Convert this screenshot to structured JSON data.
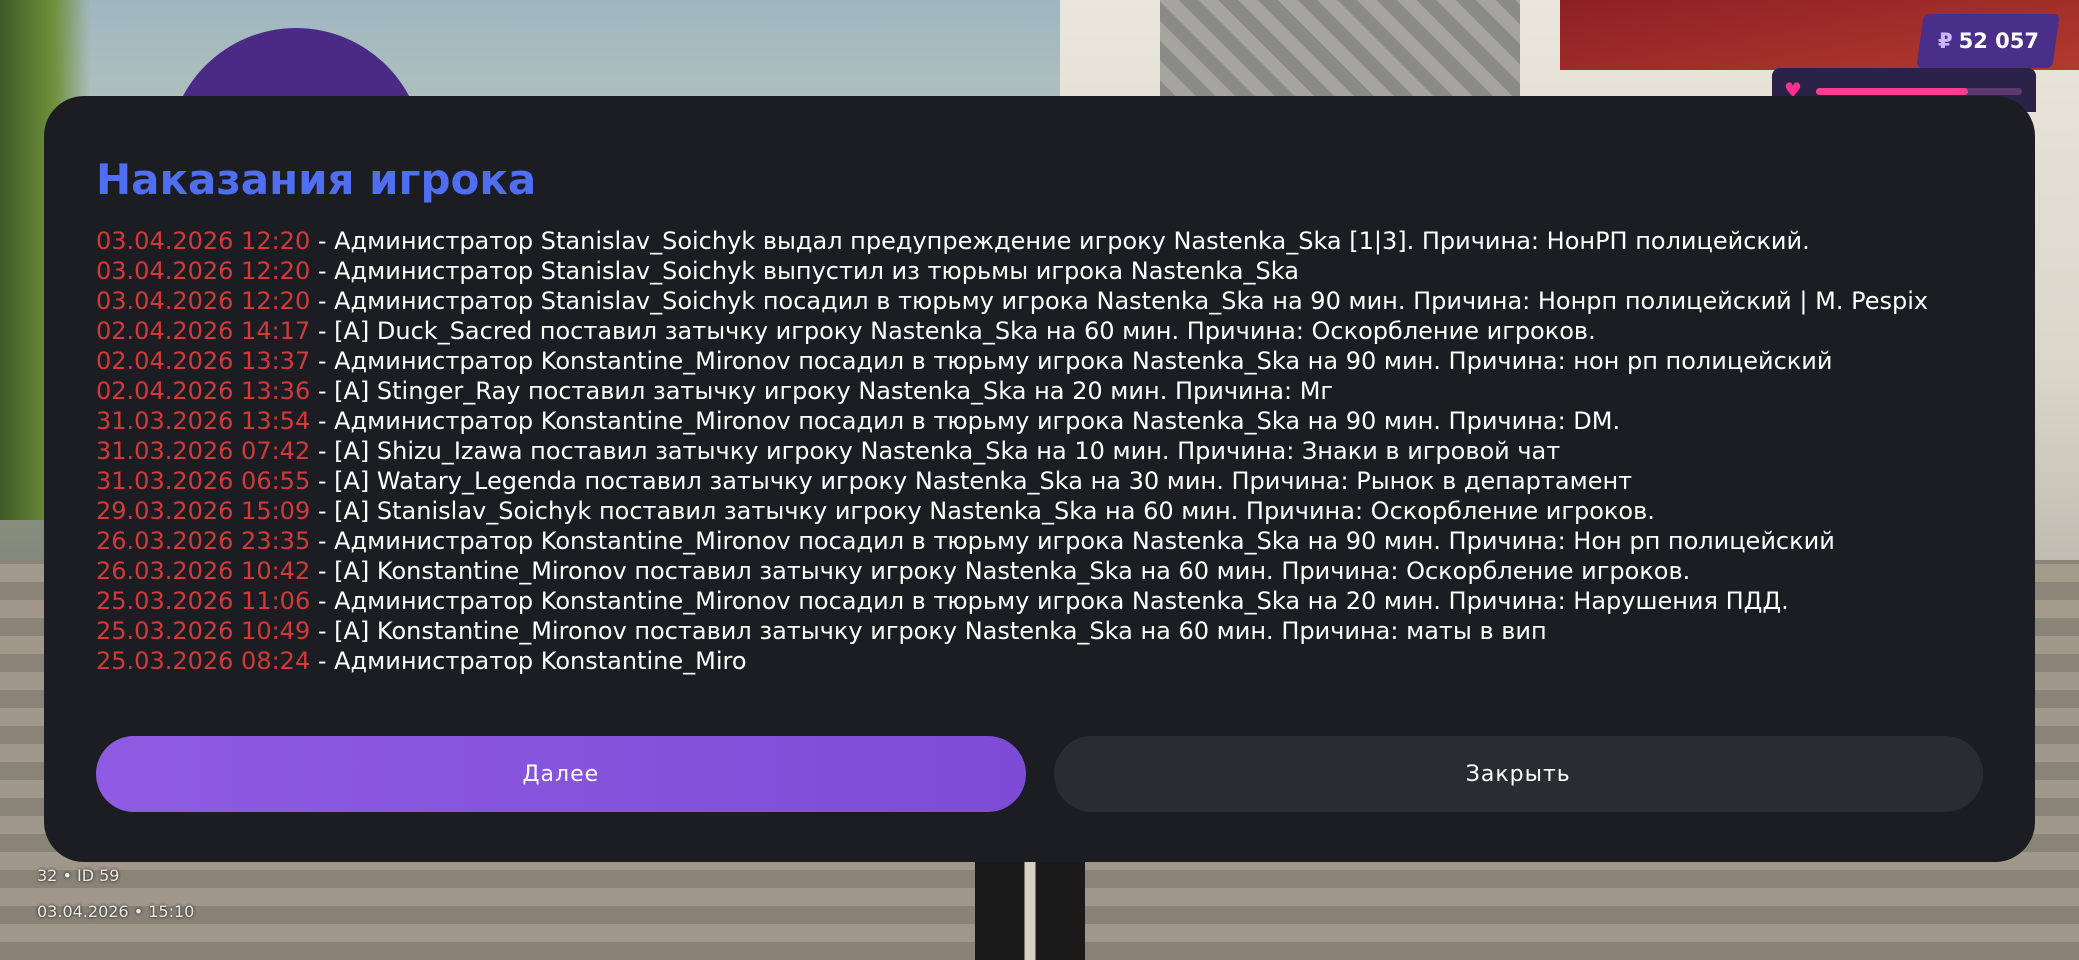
{
  "hud": {
    "money": "52 057",
    "currency_icon": "ruble-icon",
    "health_fraction": 0.74,
    "health_color": "#ff3d8f",
    "player_info": "32 • ID 59",
    "datetime": "03.04.2026 • 15:10"
  },
  "dialog": {
    "title": "Наказания игрока",
    "title_color": "#4f6ef2",
    "date_color": "#d23a3a",
    "entries": [
      {
        "date": "03.04.2026 12:20",
        "text": " - Администратор Stanislav_Soichyk выдал предупреждение игроку Nastenka_Ska [1|3]. Причина: НонРП полицейский."
      },
      {
        "date": "03.04.2026 12:20",
        "text": " - Администратор Stanislav_Soichyk выпустил из тюрьмы игрока Nastenka_Ska"
      },
      {
        "date": "03.04.2026 12:20",
        "text": " - Администратор Stanislav_Soichyk посадил в тюрьму игрока Nastenka_Ska на 90 мин. Причина: Нонрп полицейский | M. Pespix"
      },
      {
        "date": "02.04.2026 14:17",
        "text": " - [A] Duck_Sacred поставил затычку игроку Nastenka_Ska на 60 мин. Причина: Оскорбление игроков."
      },
      {
        "date": "02.04.2026 13:37",
        "text": " - Администратор Konstantine_Mironov посадил в тюрьму игрока Nastenka_Ska на 90 мин. Причина: нон рп полицейский"
      },
      {
        "date": "02.04.2026 13:36",
        "text": " - [A] Stinger_Ray поставил затычку игроку Nastenka_Ska на 20 мин. Причина: Мг"
      },
      {
        "date": "31.03.2026 13:54",
        "text": " - Администратор Konstantine_Mironov посадил в тюрьму игрока Nastenka_Ska на 90 мин. Причина: DM."
      },
      {
        "date": "31.03.2026 07:42",
        "text": " - [A] Shizu_Izawa поставил затычку игроку Nastenka_Ska на 10 мин. Причина: Знаки в игровой чат"
      },
      {
        "date": "31.03.2026 06:55",
        "text": " - [A] Watary_Legenda поставил затычку игроку Nastenka_Ska на 30 мин. Причина: Рынок в департамент"
      },
      {
        "date": "29.03.2026 15:09",
        "text": " - [A] Stanislav_Soichyk поставил затычку игроку Nastenka_Ska на 60 мин. Причина: Оскорбление игроков."
      },
      {
        "date": "26.03.2026 23:35",
        "text": " - Администратор Konstantine_Mironov посадил в тюрьму игрока Nastenka_Ska на 90 мин. Причина: Нон рп полицейский"
      },
      {
        "date": "26.03.2026 10:42",
        "text": " - [A] Konstantine_Mironov поставил затычку игроку Nastenka_Ska на 60 мин. Причина: Оскорбление игроков."
      },
      {
        "date": "25.03.2026 11:06",
        "text": " - Администратор Konstantine_Mironov посадил в тюрьму игрока Nastenka_Ska на 20 мин. Причина: Нарушения ПДД."
      },
      {
        "date": "25.03.2026 10:49",
        "text": " - [A] Konstantine_Mironov поставил затычку игроку Nastenka_Ska на 60 мин. Причина: маты в вип"
      },
      {
        "date": "25.03.2026 08:24",
        "text": " - Администратор Konstantine_Miro"
      }
    ],
    "next_label": "Далее",
    "close_label": "Закрыть"
  }
}
